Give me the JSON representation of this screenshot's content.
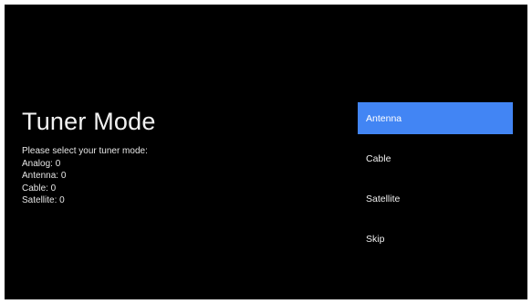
{
  "screen": {
    "title": "Tuner Mode",
    "info": {
      "prompt": "Please select your tuner mode:",
      "lines": [
        "Analog: 0",
        "Antenna: 0",
        "Cable: 0",
        "Satellite: 0"
      ]
    },
    "options": [
      {
        "label": "Antenna",
        "selected": true
      },
      {
        "label": "Cable",
        "selected": false
      },
      {
        "label": "Satellite",
        "selected": false
      },
      {
        "label": "Skip",
        "selected": false
      }
    ],
    "colors": {
      "background": "#000000",
      "accent": "#4285f4",
      "text": "#f0f0f0"
    }
  }
}
